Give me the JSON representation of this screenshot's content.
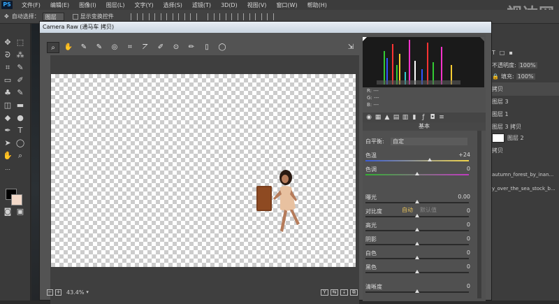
{
  "menubar": {
    "logo": "PS",
    "items": [
      "文件(F)",
      "编辑(E)",
      "图像(I)",
      "图层(L)",
      "文字(Y)",
      "选择(S)",
      "滤镜(T)",
      "3D(D)",
      "视图(V)",
      "窗口(W)",
      "帮助(H)"
    ]
  },
  "optbar": {
    "auto_select_label": "自动选择：",
    "auto_select_value": "图层",
    "show_transform_label": "显示变换控件"
  },
  "watermark": "视达网",
  "camera_raw": {
    "title": "Camera Raw (通马车 拷贝)",
    "zoom": "43.4%",
    "rgb": {
      "r": "R: ---",
      "g": "G: ---",
      "b": "B: ---"
    },
    "panel_title": "基本",
    "white_balance_label": "白平衡:",
    "white_balance_value": "自定",
    "auto_label": "自动",
    "default_label": "默认值",
    "sliders": [
      {
        "label": "色温",
        "value": "+24",
        "pos": 0.62
      },
      {
        "label": "色调",
        "value": "0",
        "pos": 0.5
      },
      {
        "label": "曝光",
        "value": "0.00",
        "pos": 0.5
      },
      {
        "label": "对比度",
        "value": "0",
        "pos": 0.5
      },
      {
        "label": "高光",
        "value": "0",
        "pos": 0.5
      },
      {
        "label": "阴影",
        "value": "0",
        "pos": 0.5
      },
      {
        "label": "白色",
        "value": "0",
        "pos": 0.5
      },
      {
        "label": "黑色",
        "value": "0",
        "pos": 0.5
      },
      {
        "label": "清晰度",
        "value": "0",
        "pos": 0.5
      }
    ]
  },
  "right_panel": {
    "opacity_label": "不透明度:",
    "opacity_value": "100%",
    "fill_label": "填充:",
    "fill_value": "100%",
    "layers": [
      "拷贝",
      "图层 3",
      "图层 1",
      "图层 3 拷贝",
      "图层 2",
      "拷贝",
      "autumn_forest_by_inan...",
      "y_over_the_sea_stock_b..."
    ]
  },
  "colors": {
    "ps_blue": "#31a8ff",
    "cr_title_bg": "#d6e0ea",
    "foreground_swatch": "#000000",
    "background_swatch": "#f3d9c9"
  }
}
